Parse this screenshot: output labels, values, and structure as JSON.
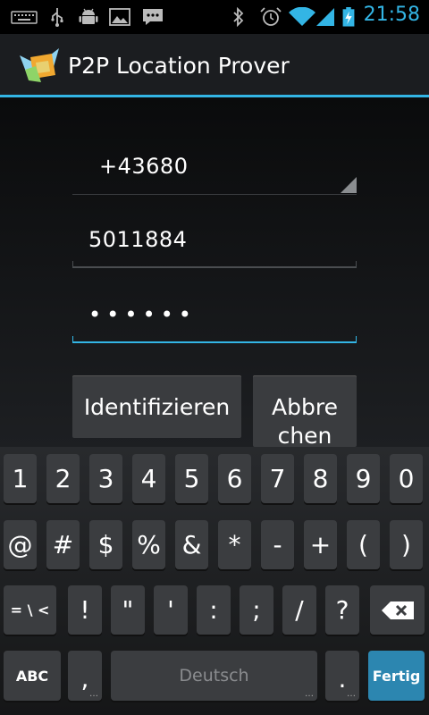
{
  "status_bar": {
    "time": "21:58",
    "icons": [
      "keyboard-icon",
      "usb-icon",
      "android-icon",
      "image-icon",
      "chat-icon",
      "bluetooth-icon",
      "alarm-icon",
      "wifi-icon",
      "signal-icon",
      "battery-charging-icon"
    ]
  },
  "action_bar": {
    "title": "P2P Location Prover",
    "logo": "app-logo-icon"
  },
  "form": {
    "country_code": "+43680",
    "phone_number": "5011884",
    "pin_masked": "••••••"
  },
  "buttons": {
    "identify": "Identifizieren",
    "cancel_line1": "Abbre",
    "cancel_line2": "chen"
  },
  "keyboard": {
    "row1": [
      "1",
      "2",
      "3",
      "4",
      "5",
      "6",
      "7",
      "8",
      "9",
      "0"
    ],
    "row2": [
      "@",
      "#",
      "$",
      "%",
      "&",
      "*",
      "-",
      "+",
      "(",
      ")"
    ],
    "row3": [
      "= \\ <",
      "!",
      "\"",
      "'",
      ":",
      ";",
      "/",
      "?"
    ],
    "abc": "ABC",
    "comma": ",",
    "space_label": "Deutsch",
    "period": ".",
    "done": "Fertig",
    "backspace_icon": "backspace-icon",
    "colors": {
      "accent": "#33b5e5",
      "done_key": "#2c86b0"
    }
  }
}
